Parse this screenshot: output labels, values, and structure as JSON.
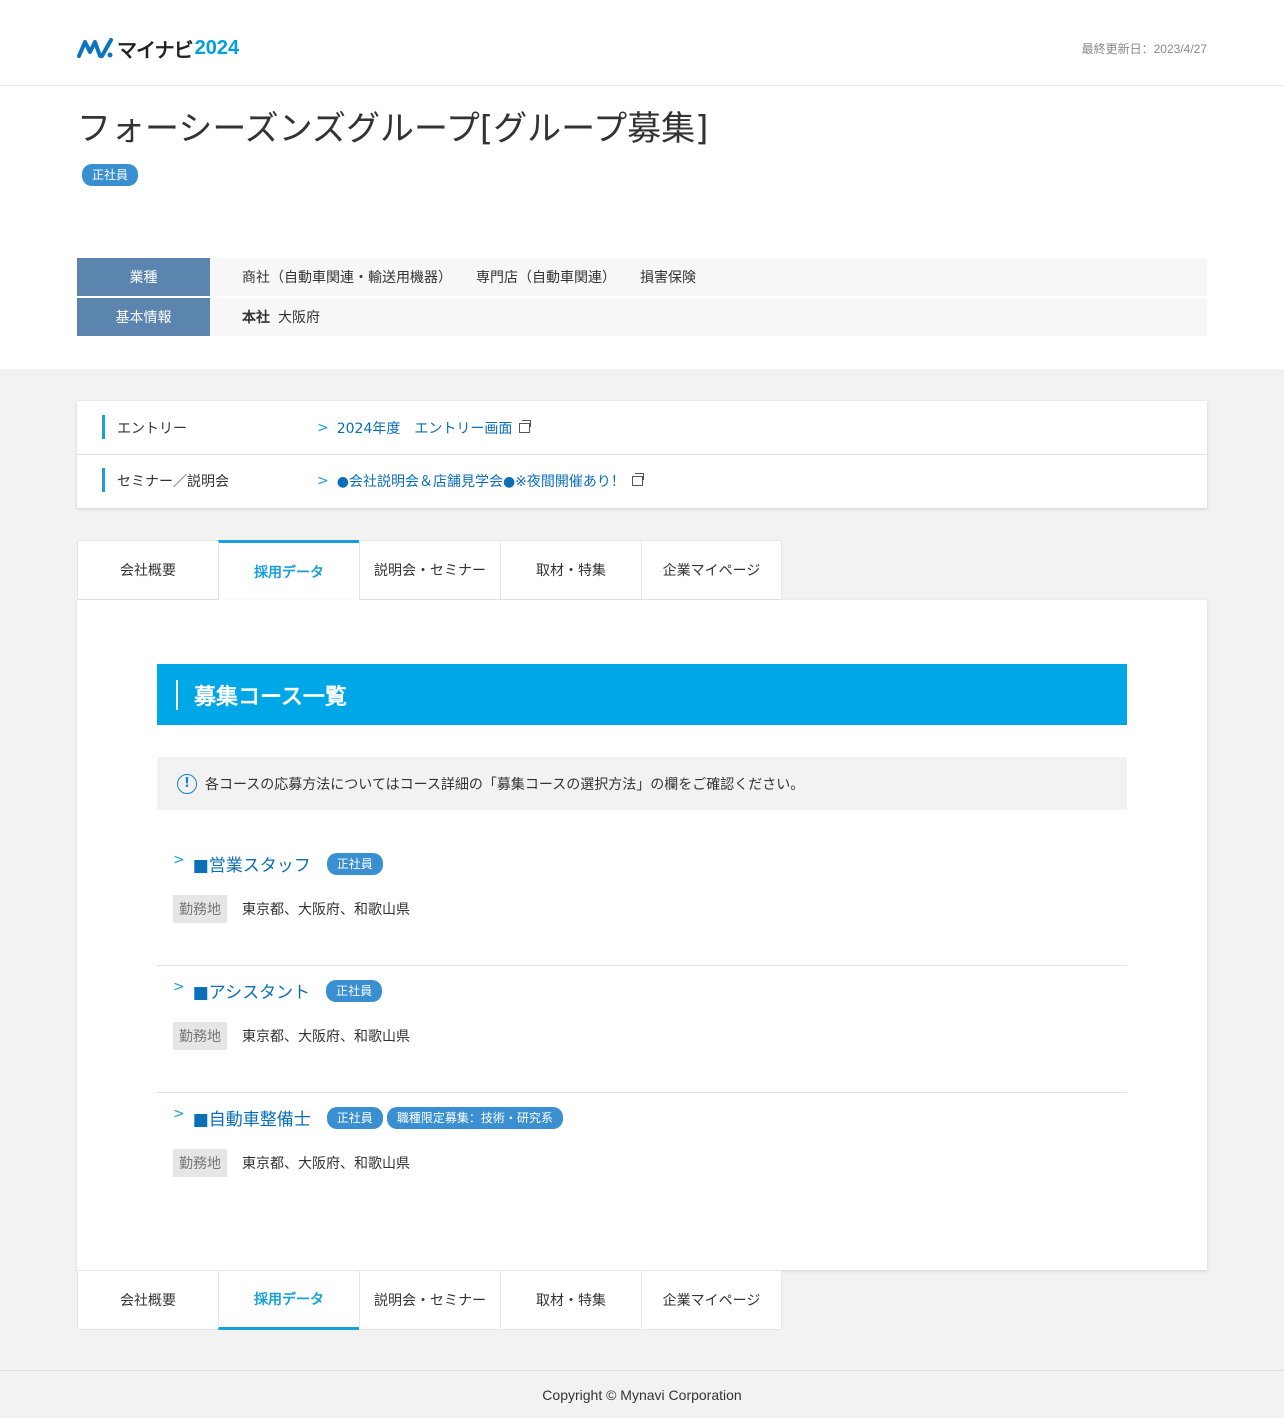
{
  "header": {
    "logo_text": "マイナビ",
    "logo_year": "2024",
    "last_updated": "最終更新日：2023/4/27"
  },
  "company": {
    "title": "フォーシーズンズグループ[グループ募集]",
    "badge": "正社員"
  },
  "info": {
    "industry_label": "業種",
    "industries": [
      "商社（自動車関連・輸送用機器）",
      "専門店（自動車関連）",
      "損害保険"
    ],
    "basic_label": "基本情報",
    "hq_label": "本社",
    "hq_value": "大阪府"
  },
  "entry": {
    "rows": [
      {
        "label": "エントリー",
        "link": "2024年度　エントリー画面"
      },
      {
        "label": "セミナー／説明会",
        "link": "●会社説明会＆店舗見学会●※夜間開催あり！"
      }
    ]
  },
  "tabs": {
    "items": [
      "会社概要",
      "採用データ",
      "説明会・セミナー",
      "取材・特集",
      "企業マイページ"
    ],
    "active": "採用データ"
  },
  "courses_section": {
    "heading": "募集コース一覧",
    "notice": "各コースの応募方法についてはコース詳細の「募集コースの選択方法」の欄をご確認ください。",
    "location_label": "勤務地",
    "courses": [
      {
        "title": "■営業スタッフ",
        "badges": [
          "正社員"
        ],
        "location": "東京都、大阪府、和歌山県"
      },
      {
        "title": "■アシスタント",
        "badges": [
          "正社員"
        ],
        "location": "東京都、大阪府、和歌山県"
      },
      {
        "title": "■自動車整備士",
        "badges": [
          "正社員",
          "職種限定募集：技術・研究系"
        ],
        "location": "東京都、大阪府、和歌山県"
      }
    ]
  },
  "footer": {
    "copyright": "Copyright © Mynavi Corporation"
  },
  "colors": {
    "accent": "#00a7e6",
    "badge": "#3a8fd1",
    "info_head": "#5b84af",
    "link": "#0b6fb8"
  }
}
